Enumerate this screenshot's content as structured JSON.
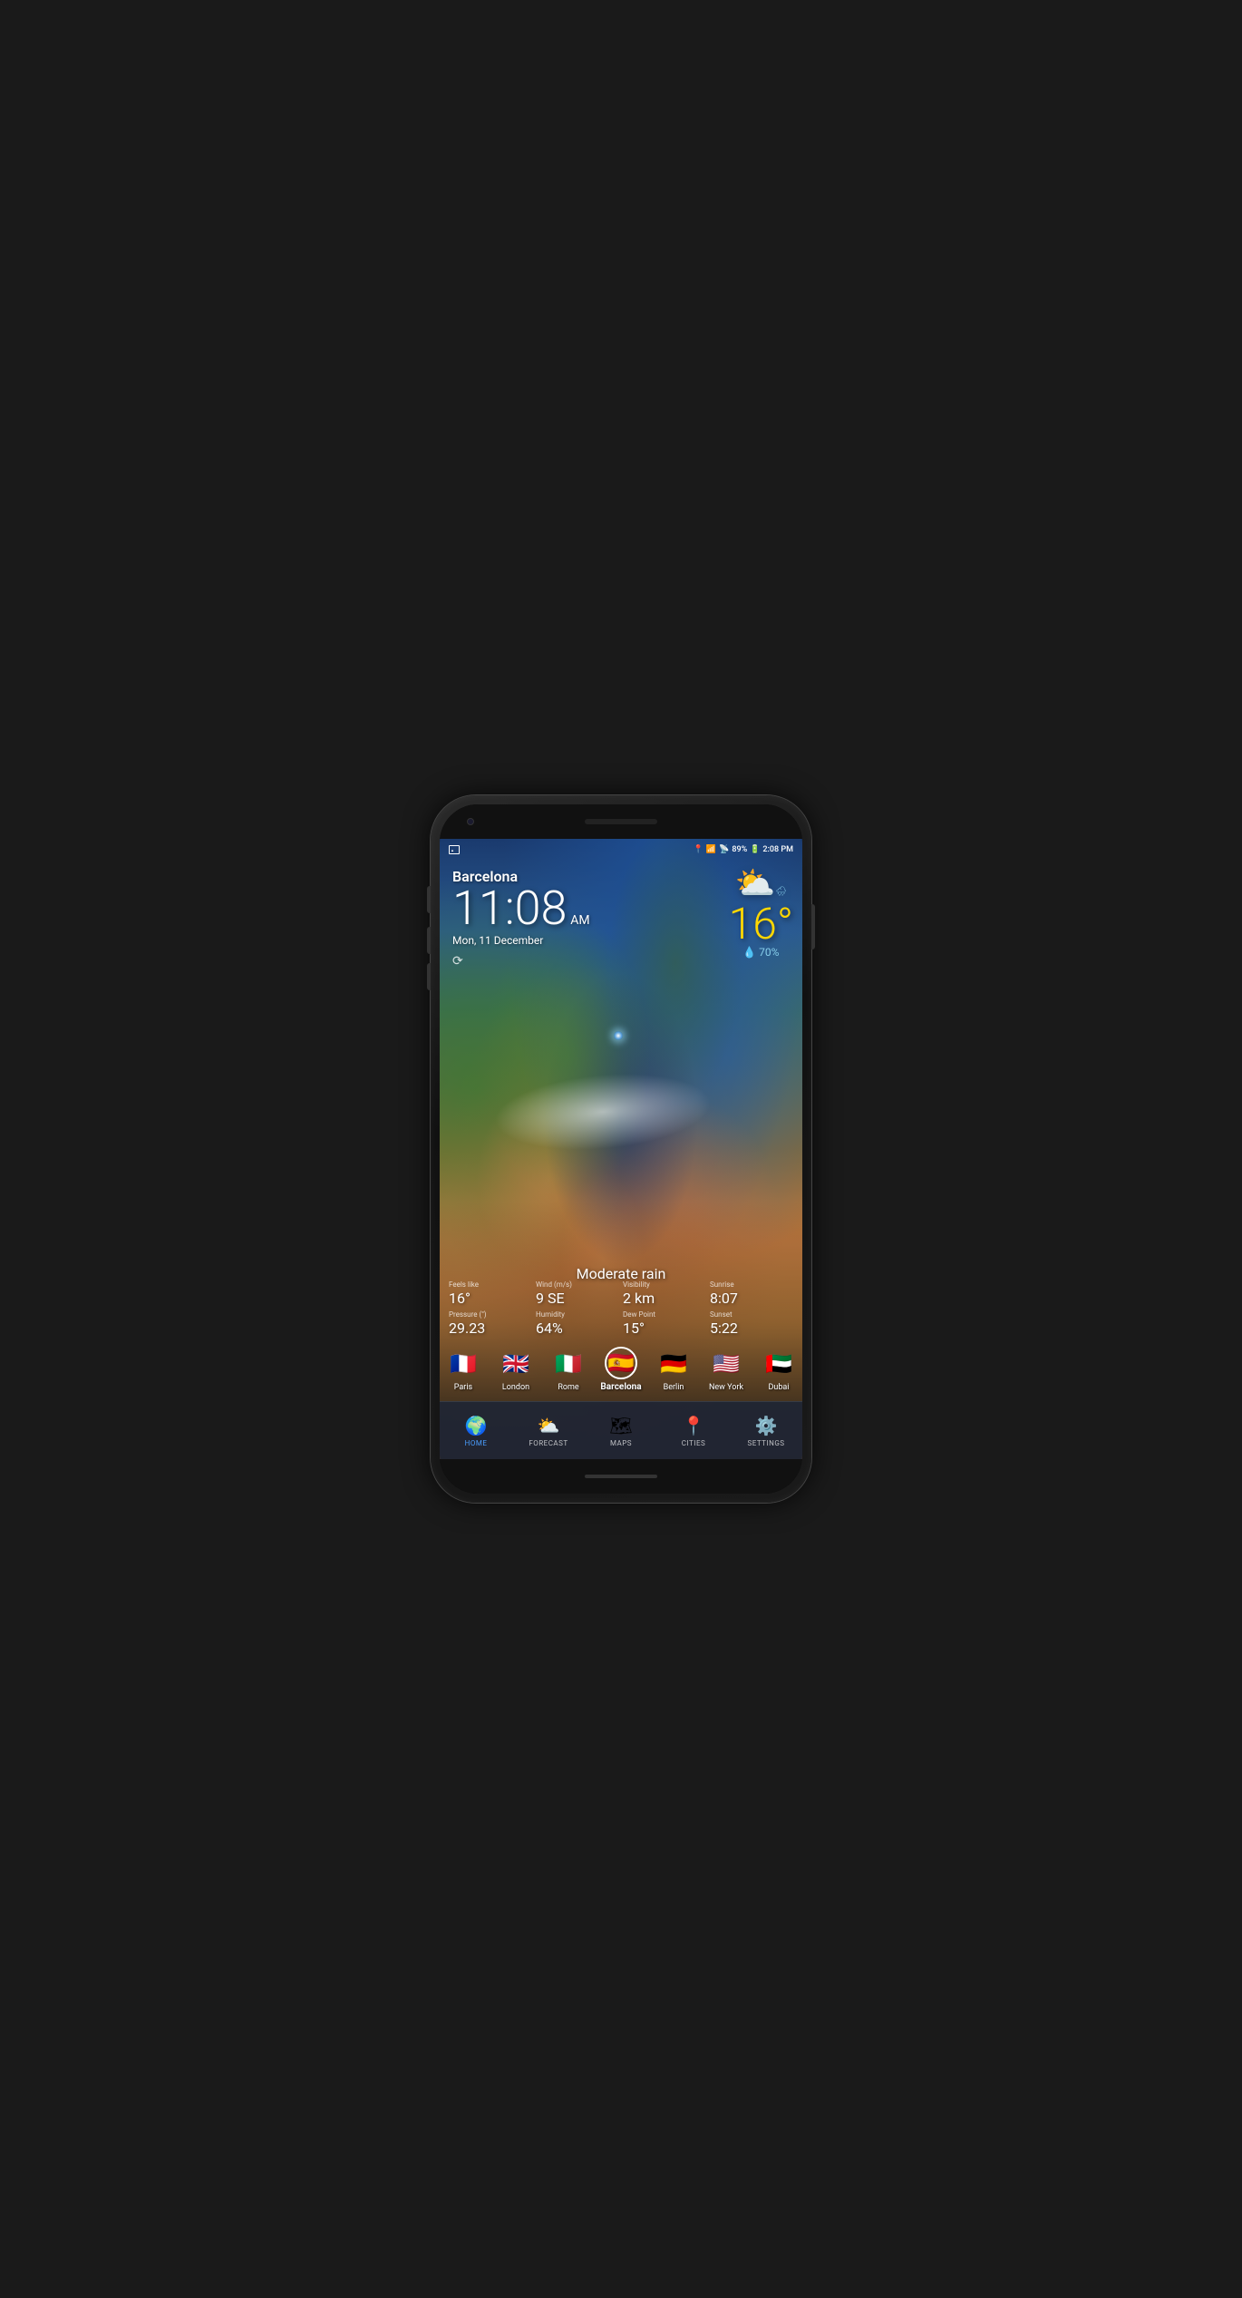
{
  "status_bar": {
    "left_icon": "image",
    "signal_icon": "location",
    "wifi_icon": "wifi",
    "cell_icon": "signal",
    "battery": "89%",
    "time": "2:08 PM"
  },
  "weather": {
    "city": "Barcelona",
    "time_hour": "11",
    "time_min": "08",
    "time_ampm": "AM",
    "date": "Mon, 11 December",
    "condition": "Moderate rain",
    "temperature": "16°",
    "humidity_label": "💧",
    "humidity_value": "70%",
    "feels_like_label": "Feels like",
    "feels_like_value": "16°",
    "wind_label": "Wind (m/s)",
    "wind_value": "9 SE",
    "visibility_label": "Visibility",
    "visibility_value": "2 km",
    "sunrise_label": "Sunrise",
    "sunrise_value": "8:07",
    "pressure_label": "Pressure (\")",
    "pressure_value": "29.23",
    "humidity_stat_label": "Humidity",
    "humidity_stat_value": "64%",
    "dew_label": "Dew Point",
    "dew_value": "15°",
    "sunset_label": "Sunset",
    "sunset_value": "5:22"
  },
  "cities": [
    {
      "name": "Paris",
      "flag": "🇫🇷",
      "selected": false
    },
    {
      "name": "London",
      "flag": "🇬🇧",
      "selected": false
    },
    {
      "name": "Rome",
      "flag": "🇮🇹",
      "selected": false
    },
    {
      "name": "Barcelona",
      "flag": "🇪🇸",
      "selected": true
    },
    {
      "name": "Berlin",
      "flag": "🇩🇪",
      "selected": false
    },
    {
      "name": "New York",
      "flag": "🇺🇸",
      "selected": false
    },
    {
      "name": "Dubai",
      "flag": "🇦🇪",
      "selected": false
    }
  ],
  "nav": {
    "items": [
      {
        "id": "home",
        "label": "HOME",
        "active": true
      },
      {
        "id": "forecast",
        "label": "FORECAST",
        "active": false
      },
      {
        "id": "maps",
        "label": "MAPS",
        "active": false
      },
      {
        "id": "cities",
        "label": "CITIES",
        "active": false
      },
      {
        "id": "settings",
        "label": "SETTINGS",
        "active": false
      }
    ]
  }
}
